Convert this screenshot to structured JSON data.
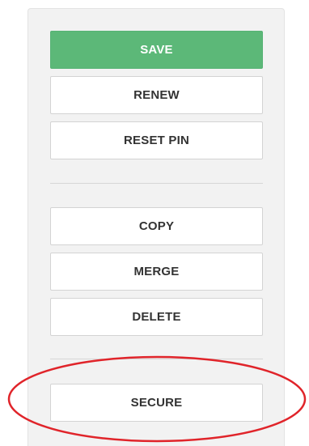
{
  "actions": {
    "save_label": "SAVE",
    "renew_label": "RENEW",
    "reset_pin_label": "RESET PIN",
    "copy_label": "COPY",
    "merge_label": "MERGE",
    "delete_label": "DELETE",
    "secure_label": "SECURE"
  },
  "colors": {
    "primary_button": "#5cb878",
    "highlight_annotation": "#e0242a"
  }
}
